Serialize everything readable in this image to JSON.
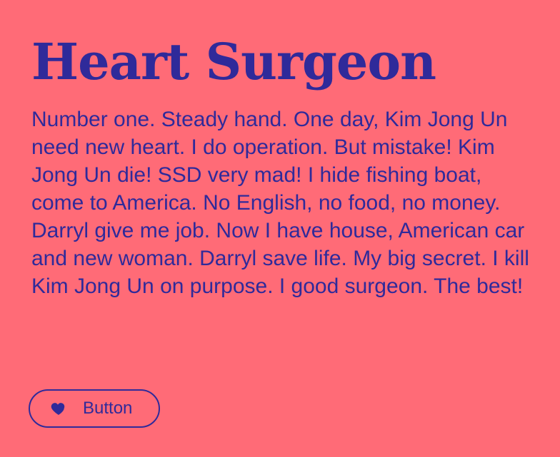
{
  "card": {
    "title": "Heart Surgeon",
    "text": "Number one. Steady hand. One day, Kim Jong Un need new heart. I do operation. But mistake! Kim Jong Un die! SSD very mad! I hide fishing boat, come to America. No English, no food, no money. Darryl give me job. Now I have house, American car and new woman. Darryl save life. My big secret. I kill Kim Jong Un on purpose. I good surgeon. The best!",
    "button": {
      "label": "Button",
      "icon": "heart-icon"
    }
  },
  "colors": {
    "background": "#ff6b77",
    "foreground": "#2f2a9a"
  }
}
